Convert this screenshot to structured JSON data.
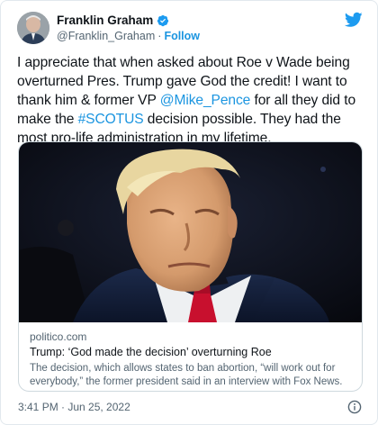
{
  "author": {
    "display_name": "Franklin Graham",
    "handle": "@Franklin_Graham",
    "separator": "·",
    "follow_label": "Follow"
  },
  "tweet": {
    "text_1": "I appreciate that when asked about Roe v Wade being overturned Pres. Trump gave God the credit! I want to thank him & former VP ",
    "mention": "@Mike_Pence",
    "text_2": " for all they did to make the ",
    "hashtag": "#SCOTUS",
    "text_3": " decision possible. They had the most pro-life administration in my lifetime."
  },
  "card": {
    "domain": "politico.com",
    "title": "Trump: ‘God made the decision’ overturning Roe",
    "description": "The decision, which allows states to ban abortion, “will work out for everybody,” the former president said in an interview with Fox News."
  },
  "footer": {
    "timestamp": "3:41 PM · Jun 25, 2022"
  },
  "colors": {
    "link": "#1b95e0",
    "verified": "#1d9bf0",
    "secondary_text": "#536471"
  },
  "icons": [
    "verified-badge-icon",
    "twitter-bird-icon",
    "info-icon"
  ]
}
